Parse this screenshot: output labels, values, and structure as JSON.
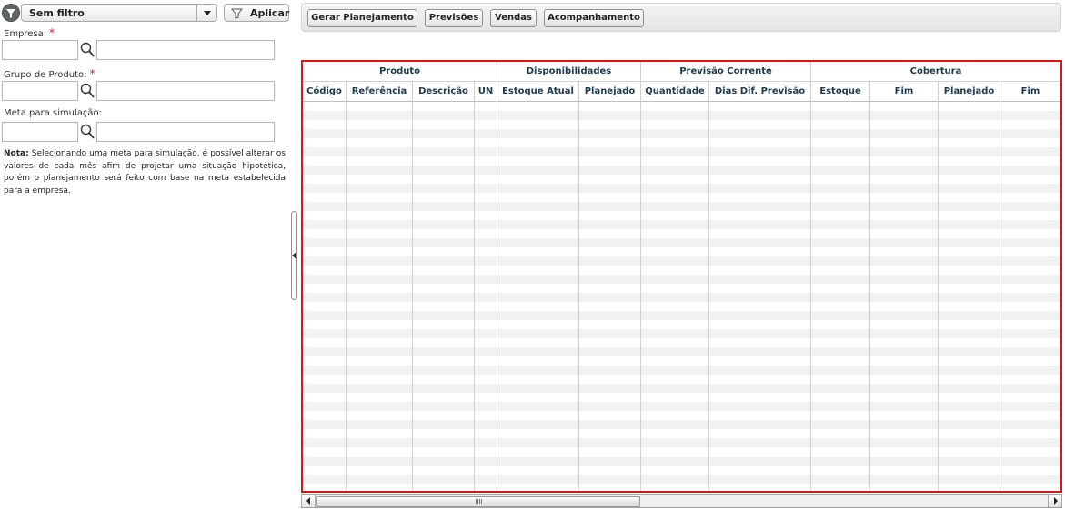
{
  "filter": {
    "selected": "Sem filtro",
    "apply_label": "Aplicar"
  },
  "fields": {
    "empresa": {
      "label": "Empresa:",
      "required_mark": "*",
      "code_value": "",
      "desc_value": ""
    },
    "grupo": {
      "label": "Grupo de Produto:",
      "required_mark": "*",
      "code_value": "",
      "desc_value": ""
    },
    "meta": {
      "label": "Meta para simulação:",
      "code_value": "",
      "desc_value": ""
    }
  },
  "note": {
    "label": "Nota:",
    "text": " Selecionando  uma meta para simulação, é possível alterar os valores de cada mês afim de projetar uma situação hipotética, porém  o  planejamento será feito  com base  na meta estabelecida para a empresa."
  },
  "toolbar": {
    "buttons": [
      "Gerar Planejamento",
      "Previsões",
      "Vendas",
      "Acompanhamento"
    ]
  },
  "grid": {
    "groups": [
      "Produto",
      "Disponibilidades",
      "Previsão Corrente",
      "Cobertura"
    ],
    "columns": [
      "Código",
      "Referência",
      "Descrição",
      "UN",
      "Estoque Atual",
      "Planejado",
      "Quantidade",
      "Dias Dif. Previsão",
      "Estoque",
      "Fim",
      "Planejado",
      "Fim"
    ],
    "rows": []
  },
  "colors": {
    "highlight_border": "#d9161c",
    "header_text": "#1d3b4f",
    "required": "#e02020"
  },
  "icons": {
    "filter": "filter-icon",
    "lookup": "magnifier-icon",
    "dropdown": "chevron-down-icon",
    "collapse": "collapse-left-icon"
  }
}
